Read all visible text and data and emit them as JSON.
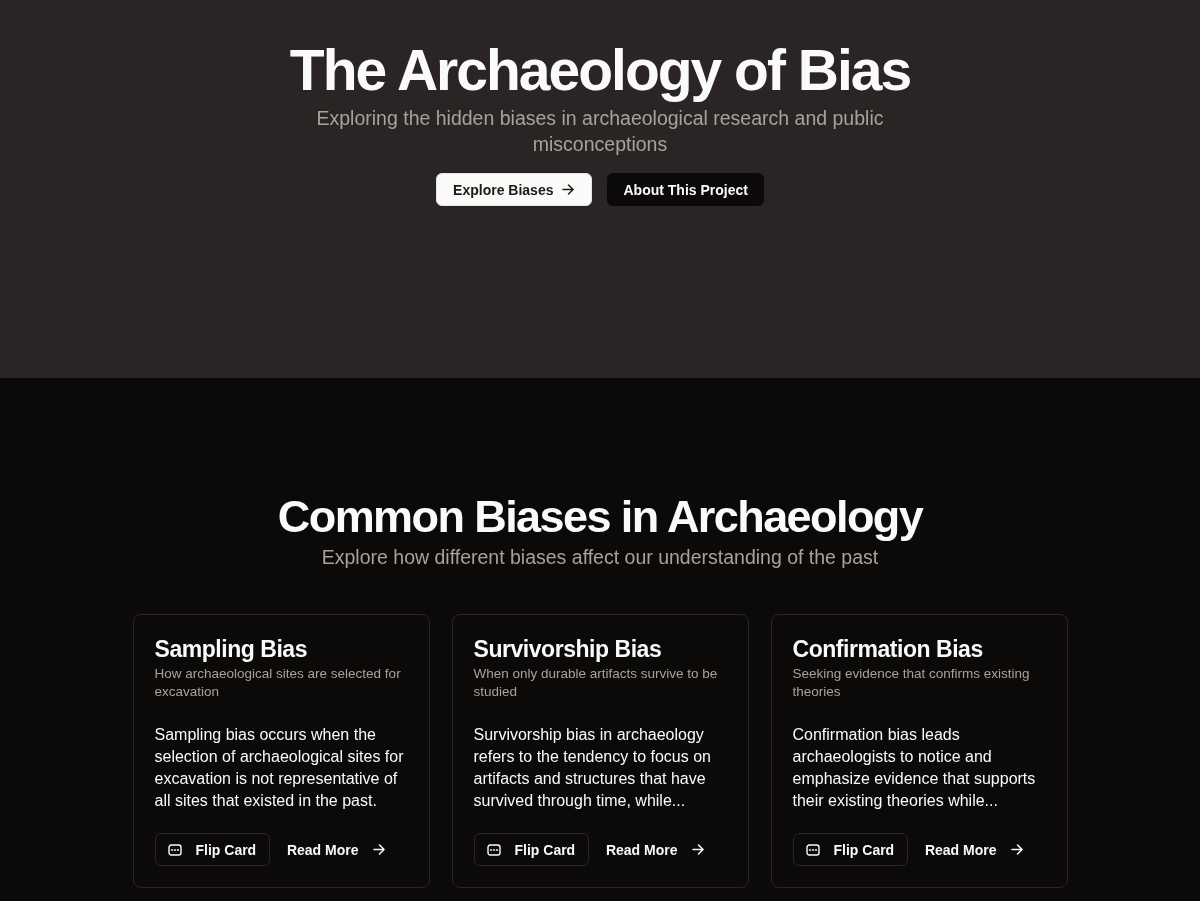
{
  "hero": {
    "title": "The Archaeology of Bias",
    "subtitle": "Exploring the hidden biases in archaeological research and public misconceptions",
    "buttons": [
      {
        "label": "Explore Biases",
        "kind": "primary"
      },
      {
        "label": "About This Project",
        "kind": "secondary"
      }
    ]
  },
  "biases_section": {
    "title": "Common Biases in Archaeology",
    "subtitle": "Explore how different biases affect our understanding of the past",
    "cards": [
      {
        "title": "Sampling Bias",
        "description": "How archaeological sites are selected for excavation",
        "body": "Sampling bias occurs when the selection of archaeological sites for excavation is not representative of all sites that existed in the past.",
        "actions": [
          {
            "label": "Flip Card",
            "kind": "flip"
          },
          {
            "label": "Read More",
            "kind": "link"
          }
        ]
      },
      {
        "title": "Survivorship Bias",
        "description": "When only durable artifacts survive to be studied",
        "body": "Survivorship bias in archaeology refers to the tendency to focus on artifacts and structures that have survived through time, while...",
        "actions": [
          {
            "label": "Flip Card",
            "kind": "flip"
          },
          {
            "label": "Read More",
            "kind": "link"
          }
        ]
      },
      {
        "title": "Confirmation Bias",
        "description": "Seeking evidence that confirms existing theories",
        "body": "Confirmation bias leads archaeologists to notice and emphasize evidence that supports their existing theories while...",
        "actions": [
          {
            "label": "Flip Card",
            "kind": "flip"
          },
          {
            "label": "Read More",
            "kind": "link"
          }
        ]
      }
    ]
  }
}
